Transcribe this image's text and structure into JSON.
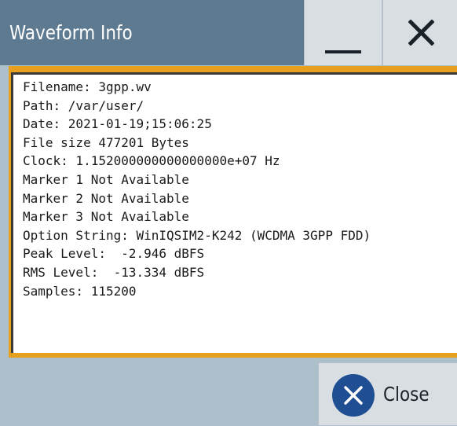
{
  "window": {
    "title": "Waveform Info",
    "minimize_icon": "minimize-icon",
    "close_icon": "close-icon"
  },
  "info": {
    "lines": [
      "Filename: 3gpp.wv",
      "Path: /var/user/",
      "Date: 2021-01-19;15:06:25",
      "File size 477201 Bytes",
      "Clock: 1.152000000000000000e+07 Hz",
      "Marker 1 Not Available",
      "Marker 2 Not Available",
      "Marker 3 Not Available",
      "Option String: WinIQSIM2-K242 (WCDMA 3GPP FDD)",
      "Peak Level:  -2.946 dBFS",
      "RMS Level:  -13.334 dBFS",
      "Samples: 115200"
    ]
  },
  "footer": {
    "close_label": "Close",
    "close_icon": "close-circle-icon"
  },
  "colors": {
    "titlebar": "#5e7a91",
    "background": "#aebfcc",
    "focus_frame": "#e6a01e",
    "close_circle": "#1f4f92"
  }
}
